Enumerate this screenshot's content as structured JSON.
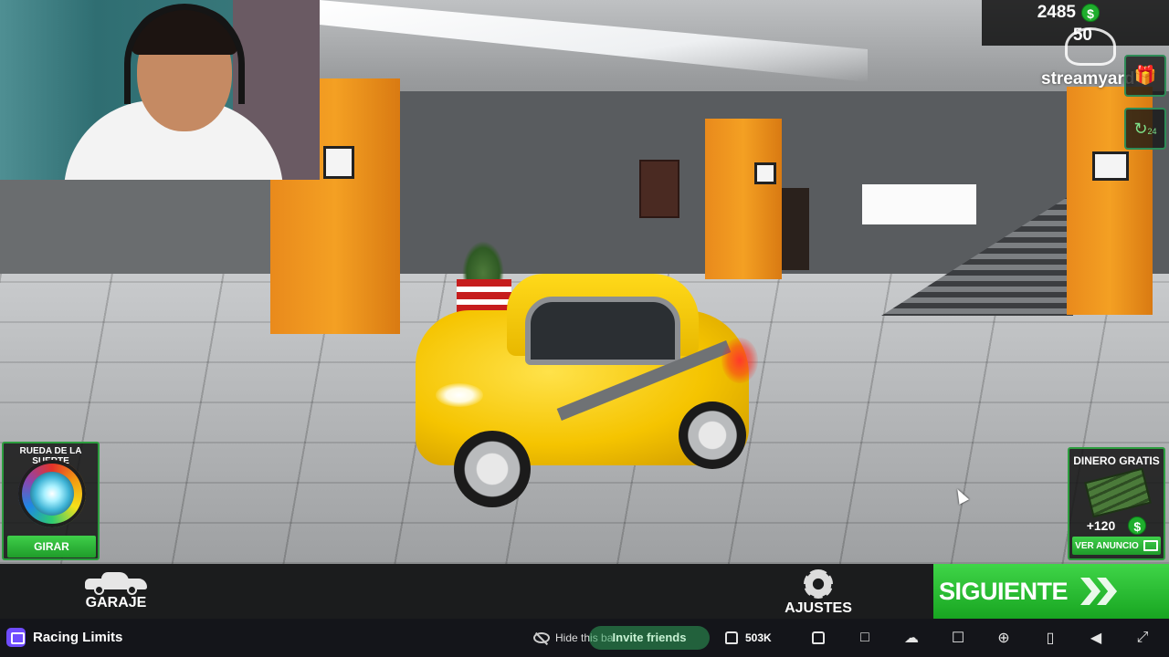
{
  "hud": {
    "money_amount": "2485",
    "money_symbol": "$",
    "secondary_amount": "50",
    "streamyard_label": "streamyard",
    "refresh_badge": "24",
    "gift_icon": "gift-icon"
  },
  "wheel_panel": {
    "title": "RUEDA DE LA SUERTE",
    "spin_label": "GIRAR"
  },
  "money_panel": {
    "title": "DINERO GRATIS",
    "reward": "+120",
    "currency_symbol": "$",
    "ad_label": "VER ANUNCIO"
  },
  "game_bar": {
    "garage_label": "GARAJE",
    "settings_label": "AJUSTES",
    "next_label": "SIGUIENTE"
  },
  "platform_bar": {
    "game_title": "Racing Limits",
    "hide_label": "Hide this ba",
    "invite_label": "Invite friends",
    "like_count": "503K"
  },
  "colors": {
    "accent_green": "#1fae2d",
    "pillar_orange": "#f4a023",
    "car_yellow": "#f5c400"
  }
}
